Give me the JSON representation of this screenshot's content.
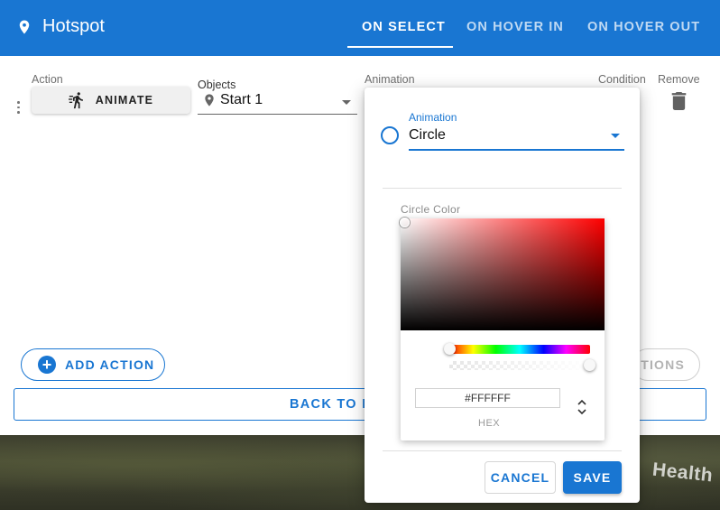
{
  "header": {
    "title": "Hotspot",
    "tabs": [
      "ON SELECT",
      "ON HOVER IN",
      "ON HOVER OUT"
    ],
    "active_tab": "ON SELECT",
    "color": "#1976d2"
  },
  "columns": {
    "action": "Action",
    "objects": "Objects",
    "animation": "Animation",
    "condition": "Condition",
    "remove": "Remove"
  },
  "row": {
    "action_button": "ANIMATE",
    "object_value": "Start 1"
  },
  "buttons": {
    "add_action": "ADD ACTION",
    "partial_actions": "CTIONS",
    "back": "BACK TO PR"
  },
  "popup": {
    "animation_label": "Animation",
    "animation_value": "Circle",
    "circle_color_label": "Circle Color",
    "hex_value": "#FFFFFF",
    "hex_label": "HEX",
    "cancel": "CANCEL",
    "save": "SAVE",
    "hue_color": "#ff0000",
    "alpha_level": 1.0
  },
  "background": {
    "label": "Health"
  },
  "icons": [
    "location-pin-icon",
    "run-icon",
    "trash-icon",
    "plus-icon",
    "drag-handle-icon",
    "unfold-icon"
  ]
}
